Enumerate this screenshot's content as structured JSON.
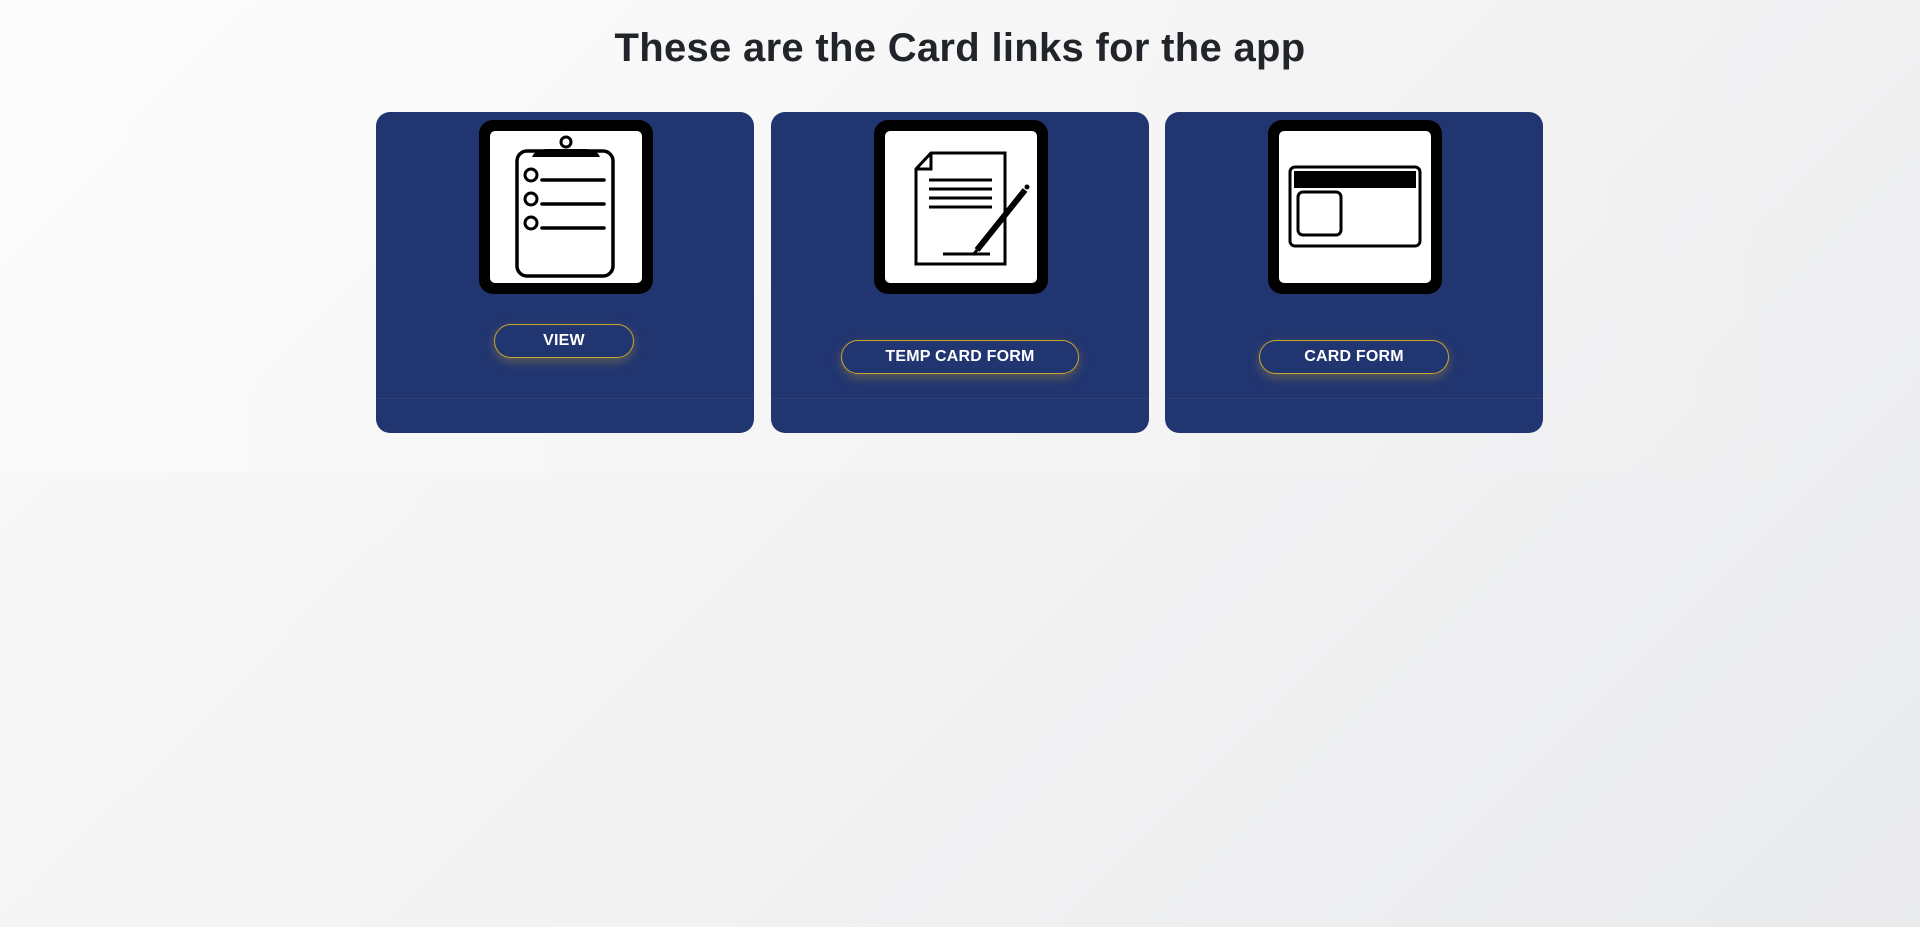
{
  "page": {
    "title": "These are the Card links for the app"
  },
  "colors": {
    "card_background": "#213571",
    "button_border": "#c8a62a",
    "title_text": "#212529"
  },
  "cards": [
    {
      "icon": "clipboard-checklist-icon",
      "button_label": "VIEW"
    },
    {
      "icon": "document-pencil-icon",
      "button_label": "TEMP CARD FORM"
    },
    {
      "icon": "id-card-icon",
      "button_label": "CARD FORM"
    }
  ]
}
